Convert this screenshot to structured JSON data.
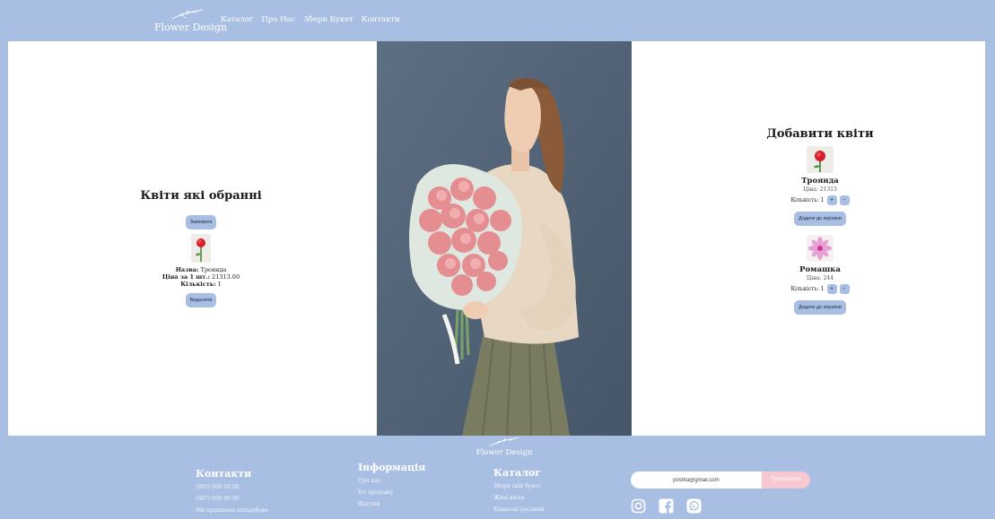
{
  "header": {
    "logo_text": "Flower Design",
    "nav": [
      "Каталог",
      "Про Нас",
      "Збери Букет",
      "Контакти"
    ]
  },
  "selected": {
    "title": "Квіти які обранні",
    "order_label": "Замовити",
    "name_label": "Назва:",
    "name_value": "Троянда",
    "price_label": "Ціна за 1 шт.:",
    "price_value": "21313.00",
    "qty_label": "Кількість:",
    "qty_value": "1",
    "remove_label": "Видалити"
  },
  "add": {
    "title": "Добавити квіти",
    "products": [
      {
        "name": "Троянда",
        "price": "Ціна: 21313",
        "qty": "Кількість: 1",
        "plus": "+",
        "minus": "-",
        "add_label": "Додати до корзини"
      },
      {
        "name": "Ромашка",
        "price": "Ціна: 244",
        "qty": "Кількість: 1",
        "plus": "+",
        "minus": "-",
        "add_label": "Додати до корзини"
      }
    ]
  },
  "footer": {
    "logo_text": "Flower Design",
    "contacts": {
      "title": "Контакти",
      "items": [
        "(095) 000 00 00",
        "(097) 000 00 00",
        "Ми працюємо цілодобово"
      ]
    },
    "info": {
      "title": "Інформація",
      "items": [
        "Про нас",
        "Хіт продажу",
        "Відгуки"
      ]
    },
    "catalog": {
      "title": "Каталог",
      "items": [
        "Збери свій букет",
        "Живі квіти",
        "Кімнатні рослини"
      ]
    },
    "subscribe": {
      "value": "poshta@gmail.com",
      "button": "Підписатися"
    },
    "socials": [
      "instagram-icon",
      "facebook-icon",
      "whatsapp-icon"
    ]
  },
  "colors": {
    "accent": "#a9bee3",
    "button_pink": "#f7c7d2"
  }
}
